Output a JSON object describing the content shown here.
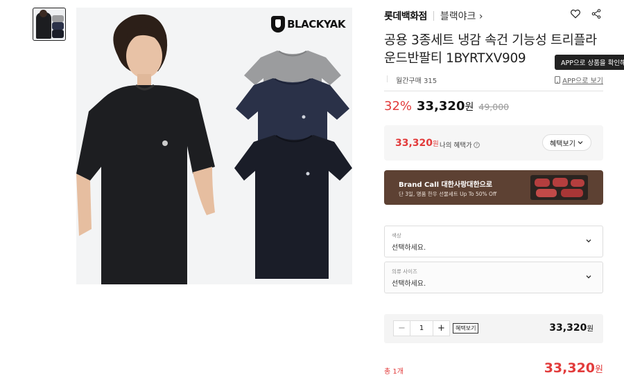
{
  "gallery": {
    "brand_logo_text": "BLACKYAK"
  },
  "seller": {
    "store": "롯데백화점",
    "brand": "블랙야크 ›"
  },
  "product": {
    "title": "공용 3종세트 냉감 속건 기능성 트리플라운드반팔티 1BYRTXV909",
    "app_badge": "APP으로 상품을 확인해",
    "monthly_purchases": "월간구매 315",
    "app_link": "APP으로 보기"
  },
  "pricing": {
    "discount": "32%",
    "price": "33,320",
    "unit": "원",
    "original": "49,000",
    "benefit_price": "33,320",
    "benefit_unit": "원",
    "benefit_label": "나의 혜택가",
    "benefit_button": "혜택보기"
  },
  "banner": {
    "title": "Brand Call 대한사랑대한으로",
    "subtitle": "단 3일, 명품 한우 선물세트 Up To 50% Off"
  },
  "options": [
    {
      "label": "색상",
      "value": "선택하세요."
    },
    {
      "label": "의류 사이즈",
      "value": "선택하세요."
    }
  ],
  "quantity": {
    "minus": "−",
    "value": "1",
    "plus": "+",
    "benefit_button": "혜택보기",
    "price": "33,320",
    "unit": "원"
  },
  "total": {
    "label": "총 1개",
    "price": "33,320",
    "unit": "원"
  },
  "colors": {
    "accent_red": "#e23b3b",
    "banner_brown": "#5d4133",
    "shirt_gray": "#9b9c9e",
    "shirt_navy": "#2a3148",
    "shirt_black": "#1a1d28"
  }
}
